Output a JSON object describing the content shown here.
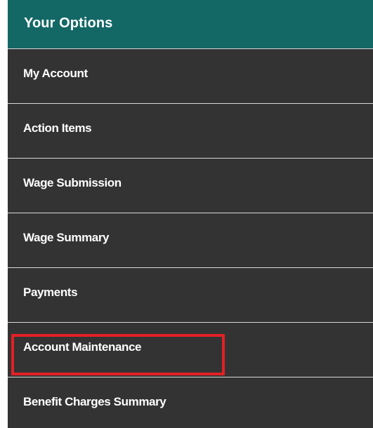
{
  "menu": {
    "header": "Your Options",
    "items": [
      {
        "label": "My Account"
      },
      {
        "label": "Action Items"
      },
      {
        "label": "Wage Submission"
      },
      {
        "label": "Wage Summary"
      },
      {
        "label": "Payments"
      },
      {
        "label": "Account Maintenance",
        "highlighted": true
      },
      {
        "label": "Benefit Charges Summary"
      }
    ]
  },
  "colors": {
    "header_bg": "#136866",
    "menu_bg": "#333333",
    "divider": "#d8d8d8",
    "highlight_border": "#e32026",
    "text": "#ffffff"
  }
}
